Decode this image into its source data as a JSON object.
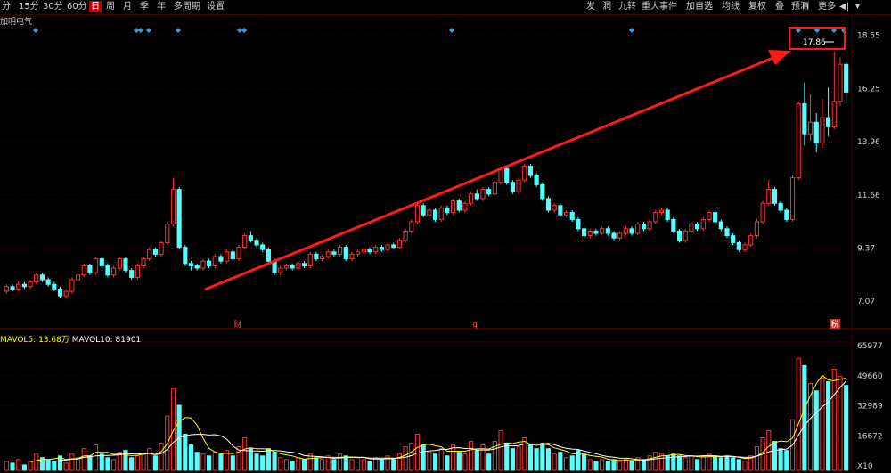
{
  "toolbar": {
    "left_items": [
      "分",
      "15分",
      "30分",
      "60分",
      "日",
      "周",
      "月",
      "季",
      "年",
      "多周期",
      "设置"
    ],
    "active": "日",
    "right_items": [
      "发",
      "洞",
      "九转",
      "重大事件",
      "加自选",
      "均线",
      "复权",
      "叠",
      "预测",
      "更多"
    ]
  },
  "stock_name": "加明电气",
  "price_axis": [
    "18.55",
    "16.25",
    "13.96",
    "11.66",
    "9.37",
    "7.07"
  ],
  "max_price_label": "17.86",
  "markers": [
    "财",
    "q",
    "税"
  ],
  "mavol": {
    "label5": "MAVOL5:",
    "value5": "13.68万",
    "label10": "MAVOL10:",
    "value10": "81901"
  },
  "volume_axis": [
    "65977",
    "49660",
    "32989",
    "16672",
    "X10"
  ],
  "colors": {
    "up": "#ff3232",
    "down": "#54ffff",
    "grid": "#3a0000",
    "ma5": "#ffff00",
    "ma10": "#ffffff",
    "trend_arrow": "#ff1a1a",
    "diamond": "#3c9bd6"
  },
  "chart_data": {
    "type": "candlestick",
    "ylim_price": [
      6.0,
      19.0
    ],
    "ylim_volume": [
      0,
      70000
    ],
    "candles": [
      [
        7.5,
        7.7,
        7.8,
        7.4,
        5000
      ],
      [
        7.7,
        7.6,
        7.8,
        7.5,
        4000
      ],
      [
        7.6,
        7.8,
        7.9,
        7.5,
        6000
      ],
      [
        7.8,
        7.7,
        7.9,
        7.6,
        3000
      ],
      [
        7.7,
        7.9,
        8.0,
        7.6,
        5000
      ],
      [
        7.9,
        8.2,
        8.3,
        7.8,
        9000
      ],
      [
        8.2,
        8.0,
        8.3,
        7.9,
        7000
      ],
      [
        8.0,
        7.8,
        8.1,
        7.7,
        6000
      ],
      [
        7.8,
        7.6,
        7.9,
        7.5,
        5000
      ],
      [
        7.6,
        7.3,
        7.7,
        7.2,
        8000
      ],
      [
        7.3,
        7.5,
        7.6,
        7.2,
        4000
      ],
      [
        7.5,
        8.0,
        8.1,
        7.4,
        9000
      ],
      [
        8.0,
        8.2,
        8.3,
        7.9,
        7000
      ],
      [
        8.2,
        8.6,
        8.7,
        8.1,
        12000
      ],
      [
        8.6,
        8.3,
        8.7,
        8.2,
        8000
      ],
      [
        8.3,
        8.9,
        9.0,
        8.2,
        14000
      ],
      [
        8.9,
        8.6,
        9.0,
        8.5,
        9000
      ],
      [
        8.6,
        8.2,
        8.7,
        8.1,
        7000
      ],
      [
        8.2,
        8.5,
        8.6,
        8.1,
        6000
      ],
      [
        8.5,
        8.9,
        9.0,
        8.4,
        10000
      ],
      [
        8.9,
        8.4,
        9.0,
        8.3,
        11000
      ],
      [
        8.4,
        8.1,
        8.5,
        8.0,
        7000
      ],
      [
        8.1,
        8.6,
        8.7,
        8.0,
        8000
      ],
      [
        8.6,
        8.9,
        9.0,
        8.5,
        9000
      ],
      [
        8.9,
        9.3,
        9.4,
        8.8,
        12000
      ],
      [
        9.3,
        9.1,
        9.4,
        9.0,
        8000
      ],
      [
        9.1,
        9.6,
        9.7,
        9.0,
        15000
      ],
      [
        9.6,
        10.4,
        10.5,
        9.5,
        30000
      ],
      [
        10.4,
        11.9,
        12.4,
        10.3,
        45000
      ],
      [
        11.9,
        9.4,
        12.0,
        9.3,
        36000
      ],
      [
        9.4,
        8.7,
        9.5,
        8.6,
        20000
      ],
      [
        8.7,
        8.6,
        8.8,
        8.4,
        14000
      ],
      [
        8.6,
        8.5,
        8.7,
        8.4,
        10000
      ],
      [
        8.5,
        8.8,
        8.9,
        8.4,
        9000
      ],
      [
        8.8,
        8.6,
        8.9,
        8.5,
        8000
      ],
      [
        8.6,
        9.0,
        9.1,
        8.5,
        10000
      ],
      [
        9.0,
        8.8,
        9.1,
        8.7,
        9000
      ],
      [
        8.8,
        9.2,
        9.3,
        8.7,
        11000
      ],
      [
        9.2,
        8.9,
        9.3,
        8.8,
        8000
      ],
      [
        8.9,
        9.4,
        9.5,
        8.8,
        13000
      ],
      [
        9.4,
        9.9,
        10.0,
        9.3,
        18000
      ],
      [
        9.9,
        9.7,
        10.1,
        9.6,
        12000
      ],
      [
        9.7,
        9.5,
        9.8,
        9.4,
        9000
      ],
      [
        9.5,
        9.3,
        9.6,
        9.2,
        8000
      ],
      [
        9.3,
        8.8,
        9.4,
        8.7,
        12000
      ],
      [
        8.8,
        8.3,
        8.9,
        8.2,
        10000
      ],
      [
        8.3,
        8.5,
        8.6,
        8.2,
        7000
      ],
      [
        8.5,
        8.6,
        8.7,
        8.4,
        6000
      ],
      [
        8.6,
        8.5,
        8.7,
        8.4,
        5000
      ],
      [
        8.5,
        8.7,
        8.8,
        8.4,
        7000
      ],
      [
        8.7,
        8.6,
        8.8,
        8.5,
        6000
      ],
      [
        8.6,
        9.1,
        9.2,
        8.5,
        9000
      ],
      [
        9.1,
        8.9,
        9.2,
        8.8,
        7000
      ],
      [
        8.9,
        9.0,
        9.1,
        8.8,
        6000
      ],
      [
        9.0,
        9.2,
        9.3,
        8.9,
        8000
      ],
      [
        9.2,
        9.1,
        9.3,
        9.0,
        6000
      ],
      [
        9.1,
        9.4,
        9.5,
        9.0,
        9000
      ],
      [
        9.4,
        8.9,
        9.5,
        8.8,
        8000
      ],
      [
        8.9,
        9.1,
        9.2,
        8.8,
        6000
      ],
      [
        9.1,
        9.2,
        9.3,
        9.0,
        7000
      ],
      [
        9.2,
        9.3,
        9.4,
        9.1,
        6000
      ],
      [
        9.3,
        9.2,
        9.4,
        9.1,
        5000
      ],
      [
        9.2,
        9.4,
        9.5,
        9.1,
        7000
      ],
      [
        9.4,
        9.3,
        9.5,
        9.2,
        6000
      ],
      [
        9.3,
        9.5,
        9.6,
        9.2,
        8000
      ],
      [
        9.5,
        9.4,
        9.6,
        9.3,
        6000
      ],
      [
        9.4,
        9.7,
        9.8,
        9.3,
        9000
      ],
      [
        9.7,
        10.1,
        10.2,
        9.6,
        13000
      ],
      [
        10.1,
        10.5,
        10.6,
        10.0,
        15000
      ],
      [
        10.5,
        11.2,
        11.3,
        10.4,
        20000
      ],
      [
        11.2,
        10.8,
        11.3,
        10.7,
        14000
      ],
      [
        10.8,
        11.0,
        11.1,
        10.7,
        10000
      ],
      [
        11.0,
        10.6,
        11.1,
        10.5,
        9000
      ],
      [
        10.6,
        11.1,
        11.2,
        10.5,
        12000
      ],
      [
        11.1,
        10.9,
        11.2,
        10.8,
        8000
      ],
      [
        10.9,
        11.4,
        11.5,
        10.8,
        14000
      ],
      [
        11.4,
        11.0,
        11.5,
        10.9,
        10000
      ],
      [
        11.0,
        11.3,
        11.4,
        10.9,
        9000
      ],
      [
        11.3,
        11.7,
        11.8,
        11.2,
        16000
      ],
      [
        11.7,
        11.5,
        11.9,
        11.4,
        11000
      ],
      [
        11.5,
        11.9,
        12.0,
        11.4,
        14000
      ],
      [
        11.9,
        11.7,
        12.0,
        11.6,
        9000
      ],
      [
        11.7,
        12.2,
        12.3,
        11.6,
        16000
      ],
      [
        12.2,
        12.8,
        12.9,
        12.1,
        22000
      ],
      [
        12.8,
        12.2,
        12.9,
        12.1,
        15000
      ],
      [
        12.2,
        11.8,
        12.3,
        11.7,
        12000
      ],
      [
        11.8,
        12.3,
        12.4,
        11.7,
        13000
      ],
      [
        12.3,
        12.9,
        13.0,
        12.2,
        18000
      ],
      [
        12.9,
        12.5,
        13.0,
        12.4,
        14000
      ],
      [
        12.5,
        12.1,
        12.6,
        12.0,
        12000
      ],
      [
        12.1,
        11.5,
        12.2,
        11.4,
        15000
      ],
      [
        11.5,
        11.0,
        11.6,
        10.9,
        12000
      ],
      [
        11.0,
        11.2,
        11.3,
        10.9,
        9000
      ],
      [
        11.2,
        10.8,
        11.3,
        10.7,
        10000
      ],
      [
        10.8,
        10.9,
        11.0,
        10.7,
        7000
      ],
      [
        10.9,
        10.6,
        11.0,
        10.5,
        8000
      ],
      [
        10.6,
        10.2,
        10.7,
        10.1,
        11000
      ],
      [
        10.2,
        9.9,
        10.3,
        9.8,
        9000
      ],
      [
        9.9,
        10.1,
        10.2,
        9.8,
        6000
      ],
      [
        10.1,
        10.0,
        10.2,
        9.9,
        5000
      ],
      [
        10.0,
        10.2,
        10.3,
        9.9,
        6000
      ],
      [
        10.2,
        10.0,
        10.3,
        9.9,
        5000
      ],
      [
        10.0,
        9.8,
        10.1,
        9.7,
        6000
      ],
      [
        9.8,
        10.0,
        10.1,
        9.7,
        5000
      ],
      [
        10.0,
        10.2,
        10.3,
        9.9,
        6000
      ],
      [
        10.2,
        10.0,
        10.3,
        9.9,
        5000
      ],
      [
        10.0,
        10.4,
        10.5,
        9.9,
        7000
      ],
      [
        10.4,
        10.2,
        10.5,
        10.1,
        6000
      ],
      [
        10.2,
        10.5,
        10.6,
        10.1,
        8000
      ],
      [
        10.5,
        10.9,
        11.0,
        10.4,
        10000
      ],
      [
        10.9,
        11.0,
        11.1,
        10.8,
        9000
      ],
      [
        11.0,
        10.6,
        11.1,
        10.5,
        8000
      ],
      [
        10.6,
        10.1,
        10.7,
        10.0,
        9000
      ],
      [
        10.1,
        9.7,
        10.2,
        9.6,
        8000
      ],
      [
        9.7,
        10.1,
        10.2,
        9.6,
        7000
      ],
      [
        10.1,
        10.4,
        10.5,
        10.0,
        8000
      ],
      [
        10.4,
        10.2,
        10.5,
        10.1,
        6000
      ],
      [
        10.2,
        10.6,
        10.7,
        10.1,
        8000
      ],
      [
        10.6,
        10.9,
        11.0,
        10.5,
        9000
      ],
      [
        10.9,
        10.5,
        11.0,
        10.4,
        8000
      ],
      [
        10.5,
        10.2,
        10.6,
        10.1,
        7000
      ],
      [
        10.2,
        9.9,
        10.3,
        9.8,
        8000
      ],
      [
        9.9,
        9.6,
        10.0,
        9.5,
        7000
      ],
      [
        9.6,
        9.3,
        9.7,
        9.2,
        6000
      ],
      [
        9.3,
        9.5,
        9.6,
        9.2,
        5000
      ],
      [
        9.5,
        9.9,
        10.0,
        9.4,
        8000
      ],
      [
        9.9,
        10.5,
        10.6,
        9.8,
        13000
      ],
      [
        10.5,
        11.3,
        11.4,
        10.4,
        18000
      ],
      [
        11.3,
        11.9,
        12.3,
        11.2,
        22000
      ],
      [
        11.9,
        11.3,
        12.0,
        11.2,
        16000
      ],
      [
        11.3,
        11.0,
        11.4,
        10.9,
        12000
      ],
      [
        11.0,
        10.6,
        11.1,
        10.5,
        11000
      ],
      [
        10.6,
        12.4,
        12.5,
        10.5,
        28000
      ],
      [
        12.4,
        15.6,
        15.7,
        12.3,
        62000
      ],
      [
        15.6,
        14.3,
        16.5,
        13.8,
        58000
      ],
      [
        14.3,
        14.8,
        16.0,
        14.0,
        48000
      ],
      [
        14.8,
        13.9,
        15.2,
        13.5,
        44000
      ],
      [
        13.9,
        15.0,
        15.8,
        13.7,
        51000
      ],
      [
        15.0,
        14.6,
        16.3,
        14.2,
        49000
      ],
      [
        14.6,
        15.7,
        17.86,
        14.5,
        56000
      ],
      [
        15.7,
        17.3,
        17.6,
        15.5,
        52000
      ],
      [
        17.3,
        16.1,
        17.4,
        15.6,
        47000
      ]
    ],
    "trend_line_label": "",
    "grid": true
  }
}
